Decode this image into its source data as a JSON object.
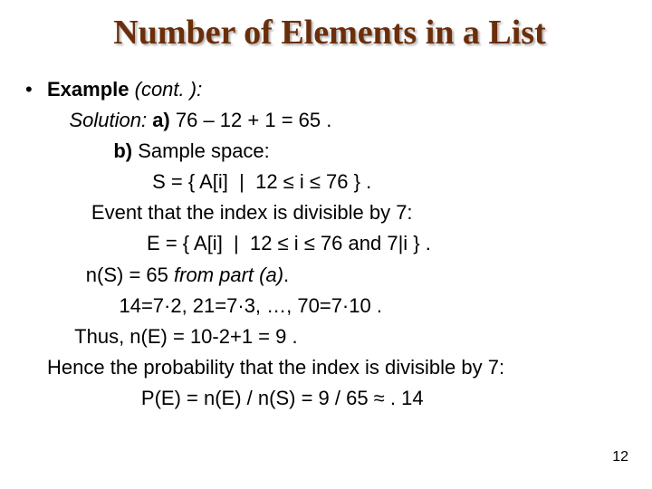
{
  "title": "Number of Elements in a List",
  "bullet_dot": "•",
  "example_label": "Example",
  "cont": " (cont. ):",
  "solution_label": "Solution:",
  "part_a_label": " a) ",
  "part_a_expr": "76 – 12 + 1 = 65 .",
  "part_b_label": "b) ",
  "part_b_text": "Sample space:",
  "s_def": "S = { A[i]  |  12 ≤ i ≤ 76 } .",
  "event_text": "Event that the index is divisible by 7:",
  "e_def": "E = { A[i]  |  12 ≤ i ≤ 76 and 7|i } .",
  "ns_prefix": "n(S) = 65 ",
  "ns_from": "from part (a)",
  "ns_dot": ".",
  "mults": "14=7·2, 21=7·3, …, 70=7·10 .",
  "ne_line": "Thus, n(E) = 10-2+1 = 9 .",
  "hence": "Hence the probability that the index is divisible by 7:",
  "pe_line": "P(E) = n(E) / n(S) = 9 / 65 ≈ . 14",
  "pagenum": "12",
  "ind": {
    "l1": "    ",
    "l2": "            ",
    "l3": "                   ",
    "l4": "        ",
    "l5": "                  ",
    "l6": "       ",
    "l7": "             ",
    "l8": "     ",
    "l9": "",
    "l10": "                 "
  }
}
